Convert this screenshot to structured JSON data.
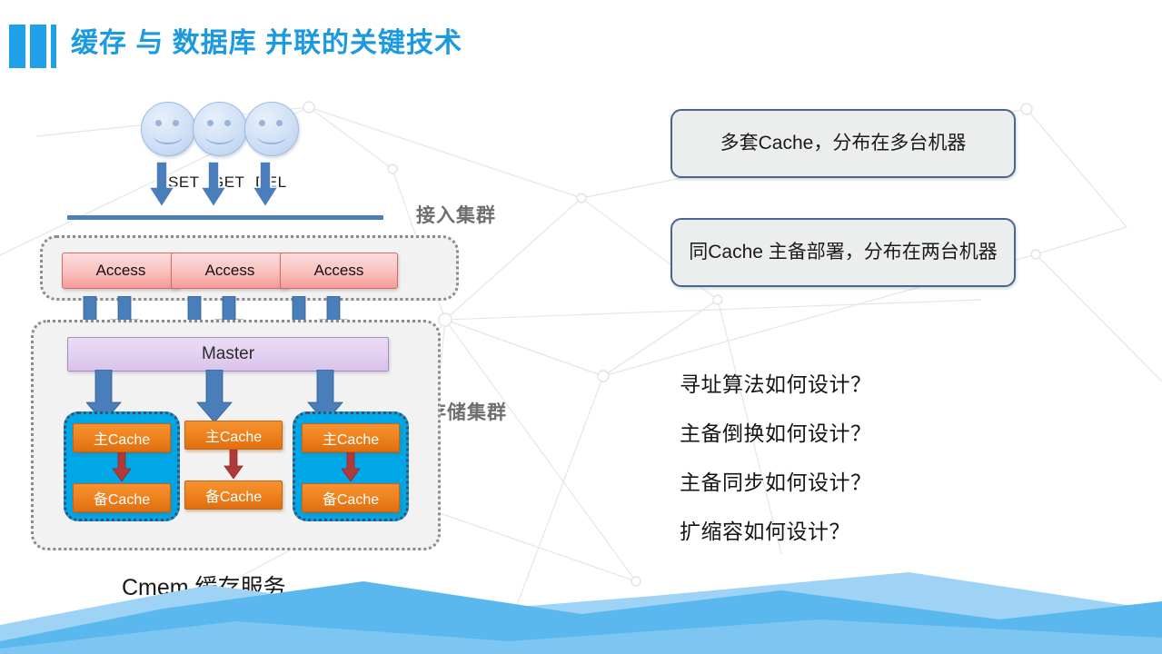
{
  "slide": {
    "title": "缓存 与 数据库  并联的关键技术",
    "title_color": "#1b9ae0",
    "caption": "Cmem 缓存服务"
  },
  "clients": {
    "operations": [
      "SET",
      "GET",
      "DEL"
    ],
    "face_count": 3
  },
  "groups": {
    "access_cluster_label": "接入集群",
    "storage_cluster_label": "存储集群"
  },
  "access_nodes": [
    {
      "label": "Access"
    },
    {
      "label": "Access"
    },
    {
      "label": "Access"
    }
  ],
  "master": {
    "label": "Master"
  },
  "cache_groups": [
    {
      "primary": "主Cache",
      "backup": "备Cache",
      "highlighted": true
    },
    {
      "primary": "主Cache",
      "backup": "备Cache",
      "highlighted": false
    },
    {
      "primary": "主Cache",
      "backup": "备Cache",
      "highlighted": true
    }
  ],
  "info_boxes": [
    {
      "text": "多套Cache，分布在多台机器"
    },
    {
      "text": "同Cache 主备部署，分布在两台机器"
    }
  ],
  "questions": [
    {
      "text": "寻址算法如何设计？"
    },
    {
      "text": "主备倒换如何设计？"
    },
    {
      "text": "主备同步如何设计？"
    },
    {
      "text": "扩缩容如何设计？"
    }
  ],
  "colors": {
    "accent_blue": "#1fa0e8",
    "access_fill": "#f59c99",
    "master_fill": "#e3d1f2",
    "cache_fill": "#ef8420",
    "highlight_cyan": "#00a7e7",
    "arrow_blue": "#3c6fa8",
    "sync_arrow_red": "#b03a3a",
    "divider": "#4a7ebb",
    "group_label_gray": "#6e6e6e"
  }
}
